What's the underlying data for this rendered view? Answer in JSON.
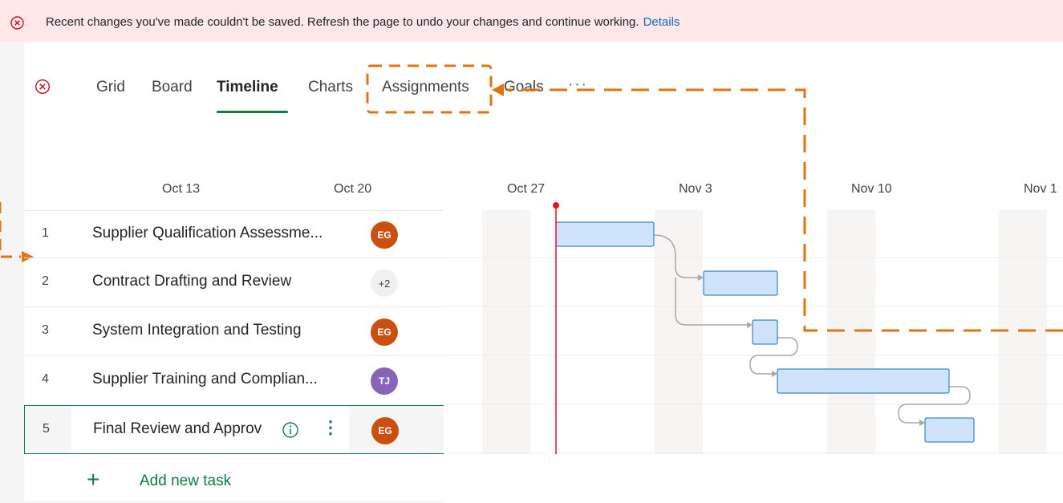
{
  "error_banner": {
    "message": "Recent changes you've made couldn't be saved. Refresh the page to undo your changes and continue working.",
    "link": "Details"
  },
  "tabs": [
    {
      "label": "Grid",
      "active": false
    },
    {
      "label": "Board",
      "active": false
    },
    {
      "label": "Timeline",
      "active": true
    },
    {
      "label": "Charts",
      "active": false
    },
    {
      "label": "Assignments",
      "active": false
    },
    {
      "label": "Goals",
      "active": false
    }
  ],
  "more_label": "···",
  "timeline": {
    "dates": [
      "Oct 13",
      "Oct 20",
      "Oct 27",
      "Nov 3",
      "Nov 10",
      "Nov 1"
    ]
  },
  "tasks": [
    {
      "num": "1",
      "name": "Supplier Qualification Assessme...",
      "assignee": "EG",
      "assignee_color": "#ca5010"
    },
    {
      "num": "2",
      "name": "Contract Drafting and Review",
      "assignee": "+2",
      "assignee_color": "#f0f0f0"
    },
    {
      "num": "3",
      "name": "System Integration and Testing",
      "assignee": "EG",
      "assignee_color": "#ca5010"
    },
    {
      "num": "4",
      "name": "Supplier Training and Complian...",
      "assignee": "TJ",
      "assignee_color": "#8764b8"
    },
    {
      "num": "5",
      "name": "Final Review and Approv",
      "assignee": "EG",
      "assignee_color": "#ca5010"
    }
  ],
  "add_task_label": "Add new task",
  "colors": {
    "accent": "#107c41",
    "error_bg": "#fde7e9",
    "error_icon": "#c50f1f",
    "bar_fill": "#cfe4fa",
    "bar_stroke": "#0f6cbd",
    "today_line": "#e81123",
    "callout": "#e3730d"
  }
}
